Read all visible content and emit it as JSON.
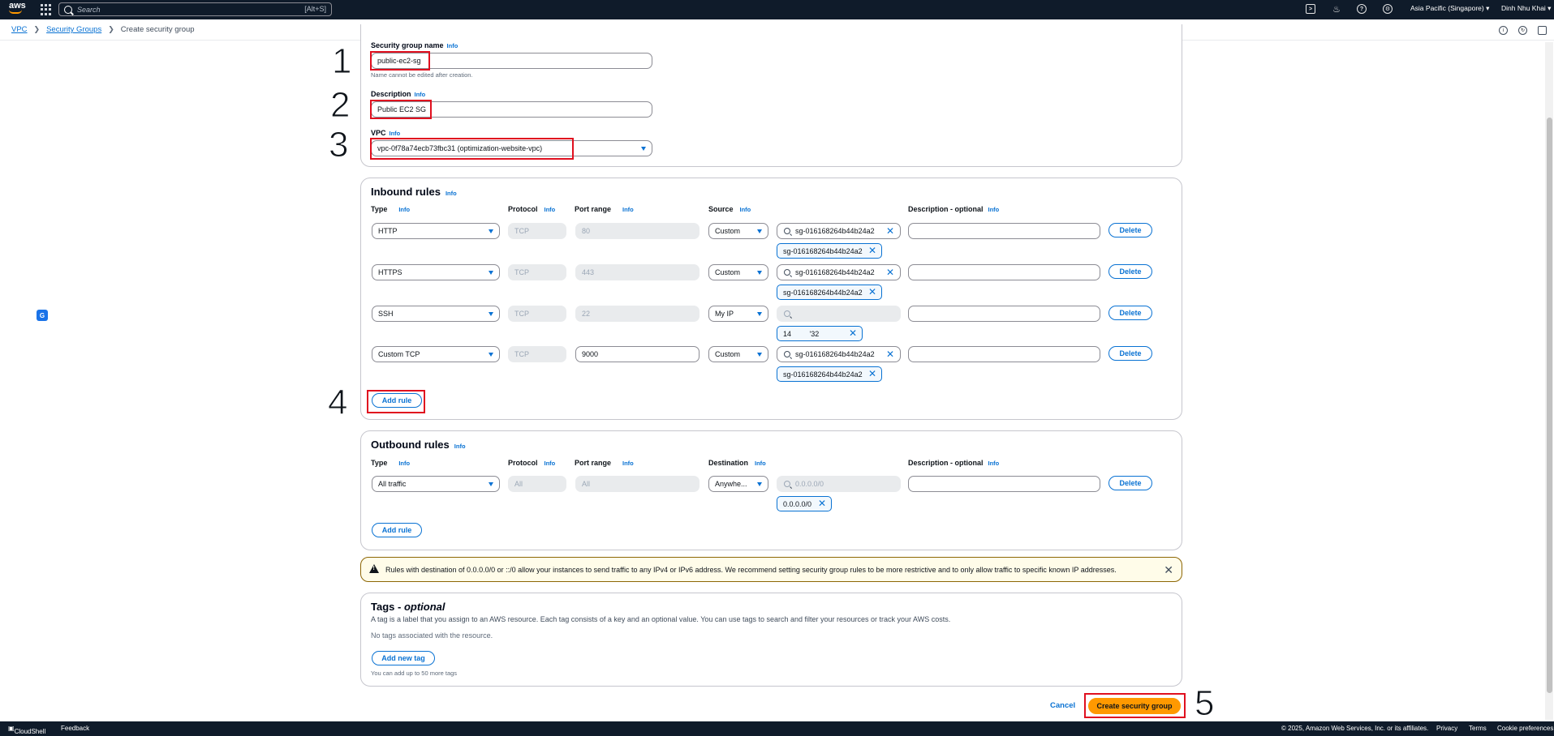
{
  "topnav": {
    "logo": "aws",
    "search_placeholder": "Search",
    "search_shortcut": "[Alt+S]",
    "region": "Asia Pacific (Singapore)",
    "user": "Dinh Nhu Khai"
  },
  "breadcrumb": {
    "items": [
      "VPC",
      "Security Groups"
    ],
    "current": "Create security group"
  },
  "basic": {
    "name_label": "Security group name",
    "name_value": "public-ec2-sg",
    "name_hint": "Name cannot be edited after creation.",
    "desc_label": "Description",
    "desc_value": "Public EC2 SG",
    "vpc_label": "VPC",
    "vpc_value": "vpc-0f78a74ecb73fbc31 (optimization-website-vpc)"
  },
  "info_label": "Info",
  "inbound": {
    "title": "Inbound rules",
    "columns": {
      "type": "Type",
      "protocol": "Protocol",
      "port": "Port range",
      "source": "Source",
      "desc": "Description - optional"
    },
    "rules": [
      {
        "type": "HTTP",
        "protocol": "TCP",
        "port": "80",
        "source": "Custom",
        "search": "sg-016168264b44b24a2",
        "token": "sg-016168264b44b24a2"
      },
      {
        "type": "HTTPS",
        "protocol": "TCP",
        "port": "443",
        "source": "Custom",
        "search": "sg-016168264b44b24a2",
        "token": "sg-016168264b44b24a2"
      },
      {
        "type": "SSH",
        "protocol": "TCP",
        "port": "22",
        "source": "My IP",
        "search": "",
        "token": "14         '32"
      },
      {
        "type": "Custom TCP",
        "protocol": "TCP",
        "port": "9000",
        "source": "Custom",
        "search": "sg-016168264b44b24a2",
        "token": "sg-016168264b44b24a2"
      }
    ],
    "delete_label": "Delete",
    "add_rule": "Add rule"
  },
  "outbound": {
    "title": "Outbound rules",
    "columns": {
      "type": "Type",
      "protocol": "Protocol",
      "port": "Port range",
      "dest": "Destination",
      "desc": "Description - optional"
    },
    "rule": {
      "type": "All traffic",
      "protocol": "All",
      "port": "All",
      "dest": "Anywhe...",
      "search": "0.0.0.0/0",
      "token": "0.0.0.0/0"
    },
    "delete_label": "Delete",
    "add_rule": "Add rule"
  },
  "warning": "Rules with destination of 0.0.0.0/0 or ::/0 allow your instances to send traffic to any IPv4 or IPv6 address. We recommend setting security group rules to be more restrictive and to only allow traffic to specific known IP addresses.",
  "tags": {
    "title": "Tags - ",
    "title_optional": "optional",
    "description": "A tag is a label that you assign to an AWS resource. Each tag consists of a key and an optional value. You can use tags to search and filter your resources or track your AWS costs.",
    "empty": "No tags associated with the resource.",
    "add_button": "Add new tag",
    "limit": "You can add up to 50 more tags"
  },
  "actions": {
    "cancel": "Cancel",
    "create": "Create security group"
  },
  "annotations": [
    "1",
    "2",
    "3",
    "4",
    "5"
  ],
  "footer": {
    "cloudshell": "CloudShell",
    "feedback": "Feedback",
    "copyright": "© 2025, Amazon Web Services, Inc. or its affiliates.",
    "privacy": "Privacy",
    "terms": "Terms",
    "cookies": "Cookie preferences"
  },
  "colors": {
    "nav_bg": "#0f1b2a",
    "link": "#0972d3",
    "primary": "#ff9900",
    "annotation_red": "#e0101f",
    "warning_bg": "#fffce9"
  }
}
